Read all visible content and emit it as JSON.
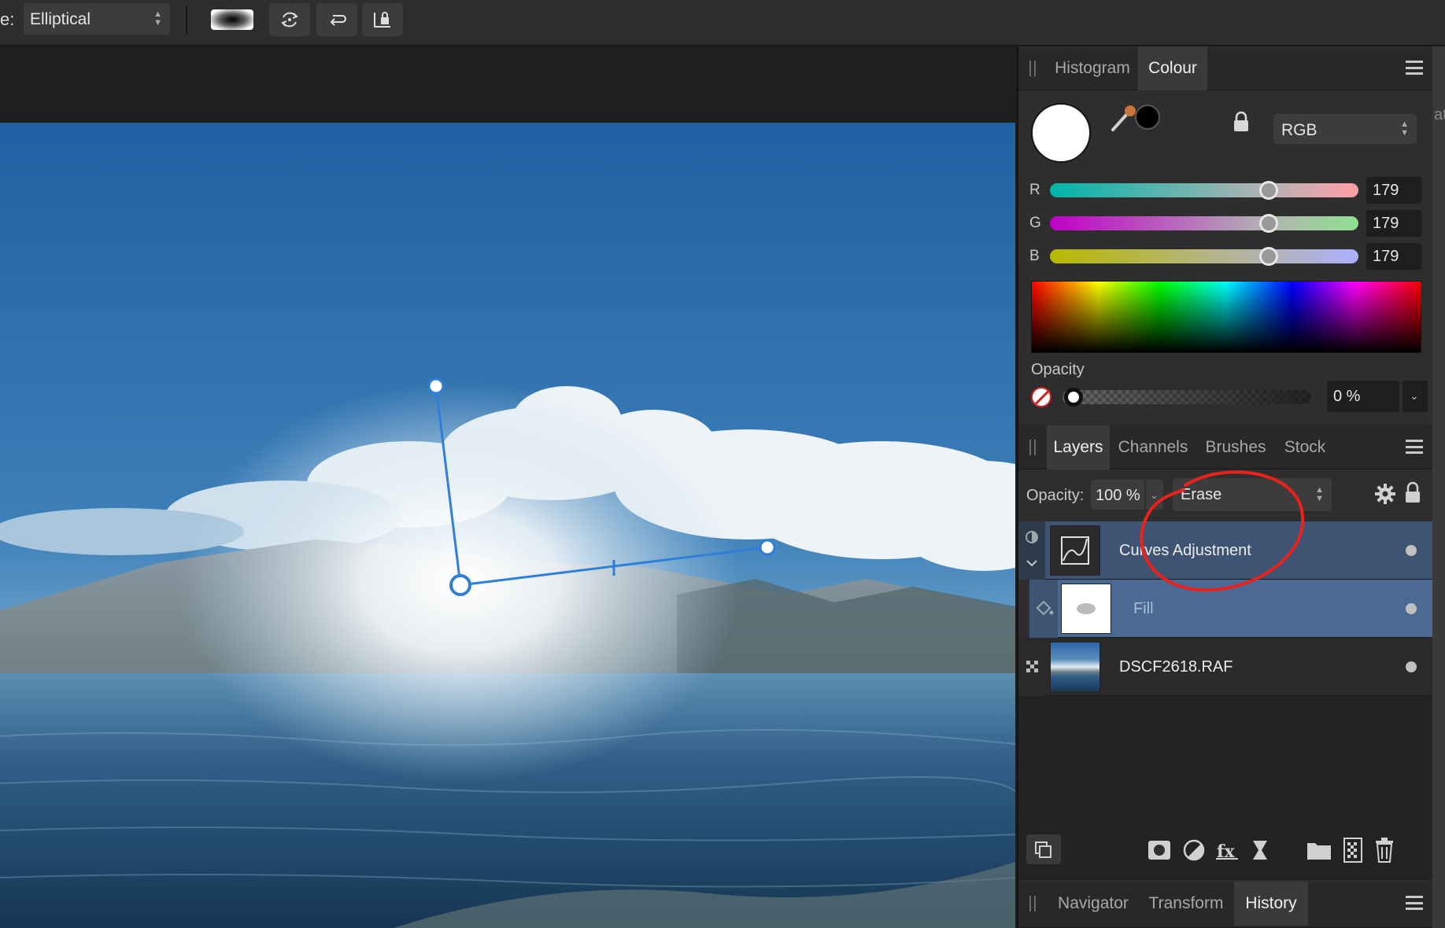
{
  "toolbar": {
    "type_label": "e:",
    "type_select": "Elliptical"
  },
  "colour_panel": {
    "tabs": [
      {
        "label": "Histogram",
        "active": false
      },
      {
        "label": "Colour",
        "active": true
      }
    ],
    "primary_color": "#ffffff",
    "secondary_color": "#000000",
    "model": "RGB",
    "channels": [
      {
        "label": "R",
        "value": "179"
      },
      {
        "label": "G",
        "value": "179"
      },
      {
        "label": "B",
        "value": "179"
      }
    ],
    "opacity_label": "Opacity",
    "opacity_value": "0 %"
  },
  "layers_panel": {
    "tabs": [
      {
        "label": "Layers",
        "active": true
      },
      {
        "label": "Channels",
        "active": false
      },
      {
        "label": "Brushes",
        "active": false
      },
      {
        "label": "Stock",
        "active": false
      }
    ],
    "opacity_label": "Opacity:",
    "opacity_value": "100 %",
    "blend_mode": "Erase",
    "layers": [
      {
        "name": "Curves Adjustment",
        "selected": true
      },
      {
        "name": "Fill",
        "selected": true
      },
      {
        "name": "DSCF2618.RAF",
        "selected": false
      }
    ]
  },
  "bottom_panel": {
    "tabs": [
      {
        "label": "Navigator",
        "active": false
      },
      {
        "label": "Transform",
        "active": false
      },
      {
        "label": "History",
        "active": true
      }
    ]
  },
  "right_strip_text": "at",
  "colors": {
    "accent_blue": "#2f7fd8",
    "annotation_red": "#e8221c",
    "selected_row": "#3e5472",
    "selected_row_fill": "#4a6a94"
  }
}
